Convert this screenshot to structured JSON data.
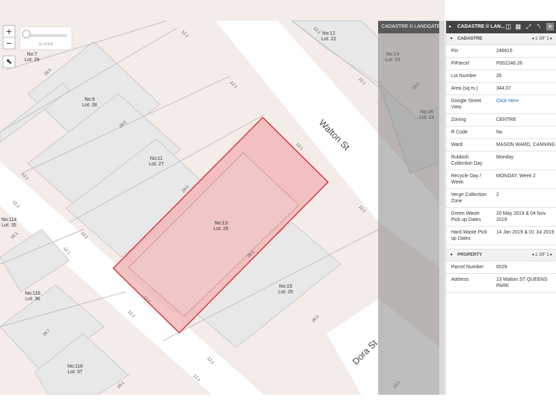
{
  "map": {
    "slider_label": "SLIDER",
    "zoom_in": "+",
    "zoom_out": "−",
    "select_tool": "⬉",
    "cadastre_header": "CADASTRE © LANDGATE ...",
    "streets": [
      "Walton St",
      "Dora St"
    ],
    "lots": [
      {
        "no": "No:12",
        "lot": "Lot: 22"
      },
      {
        "no": "No:14",
        "lot": "Lot: 23"
      },
      {
        "no": "No:16",
        "lot": "Lot: 24"
      },
      {
        "no": "No:7",
        "lot": "Lot: 29"
      },
      {
        "no": "No:9",
        "lot": "Lot: 28"
      },
      {
        "no": "No:11",
        "lot": "Lot: 27"
      },
      {
        "no": "No:13",
        "lot": "Lot: 26"
      },
      {
        "no": "No:15",
        "lot": "Lot: 25"
      },
      {
        "no": "No:114",
        "lot": "Lot: 35"
      },
      {
        "no": "No:116",
        "lot": "Lot: 36"
      },
      {
        "no": "No:118",
        "lot": "Lot: 37"
      }
    ],
    "dims": [
      "12.1",
      "28.5",
      "20.1",
      "29.7",
      "28.1",
      "23.5"
    ]
  },
  "panel": {
    "title": "CADASTRE © LAN...",
    "arrow": "▸",
    "cadastre": {
      "title": "CADASTRE",
      "paging": "1 OF 1",
      "rows": [
        {
          "k": "Pin",
          "v": "246815"
        },
        {
          "k": "PiParcel",
          "v": "P002246 26"
        },
        {
          "k": "Lot Number",
          "v": "26"
        },
        {
          "k": "Area (sq.m.)",
          "v": "344.07"
        },
        {
          "k": "Google Street View",
          "v": "Click Here"
        },
        {
          "k": "Zoning",
          "v": "CENTRE"
        },
        {
          "k": "R Code",
          "v": "No"
        },
        {
          "k": "Ward",
          "v": "MASON WARD, CANNING"
        },
        {
          "k": "Rubbish Collection Day",
          "v": "Monday"
        },
        {
          "k": "Recycle Day / Week",
          "v": "MONDAY, Week 2"
        },
        {
          "k": "Verge Collection Zone",
          "v": "2"
        },
        {
          "k": "Green Waste Pick up Dates",
          "v": "20 May 2019 & 04 Nov 2019"
        },
        {
          "k": "Hard Waste Pick up Dates",
          "v": "14 Jan 2019 & 01 Jul 2019"
        }
      ]
    },
    "property": {
      "title": "PROPERTY",
      "paging": "1 OF 1",
      "rows": [
        {
          "k": "Parcel Number",
          "v": "6529"
        },
        {
          "k": "Address",
          "v": "13 Walton ST QUEENS PARK"
        }
      ]
    }
  },
  "colors": {
    "selected_fill": "#f2b8b8",
    "selected_stroke": "#d9303a",
    "block": "#f3e9e5",
    "building": "#e9e9e9",
    "link": "#1a6fc4"
  }
}
